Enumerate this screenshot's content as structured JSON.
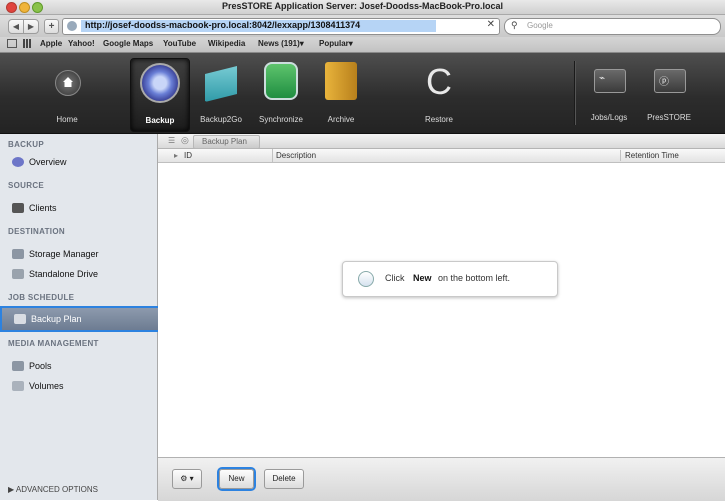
{
  "window": {
    "title": "PresSTORE Application Server: Josef-Doodss-MacBook-Pro.local"
  },
  "browser": {
    "url": "http://josef-doodss-macbook-pro.local:8042/lexxapp/1308411374",
    "search_placeholder": "Google",
    "bookmarks": [
      "Apple",
      "Yahoo!",
      "Google Maps",
      "YouTube",
      "Wikipedia",
      "News (191)▾",
      "Popular▾"
    ]
  },
  "toolbar": {
    "home": "Home",
    "backup": "Backup",
    "backup2go": "Backup2Go",
    "synchronize": "Synchronize",
    "archive": "Archive",
    "restore": "Restore",
    "jobslogs": "Jobs/Logs",
    "presstore": "PresSTORE"
  },
  "sidebar": {
    "backup_header": "BACKUP",
    "overview": "Overview",
    "source_header": "SOURCE",
    "clients": "Clients",
    "destination_header": "DESTINATION",
    "storage_manager": "Storage Manager",
    "standalone_drive": "Standalone Drive",
    "job_schedule_header": "JOB SCHEDULE",
    "backup_plan": "Backup Plan",
    "media_management_header": "MEDIA MANAGEMENT",
    "pools": "Pools",
    "volumes": "Volumes",
    "advanced_options": "▶ ADVANCED OPTIONS"
  },
  "main": {
    "breadcrumb": "Backup Plan",
    "columns": {
      "id": "ID",
      "description": "Description",
      "retention": "Retention Time"
    },
    "hint": {
      "pre": "Click",
      "strong": "New",
      "post": "on the bottom left."
    }
  },
  "bottombar": {
    "new_label": "New",
    "delete_label": "Delete",
    "gear_label": "⚙ ▾"
  },
  "colors": {
    "highlight": "#2c82e0"
  }
}
